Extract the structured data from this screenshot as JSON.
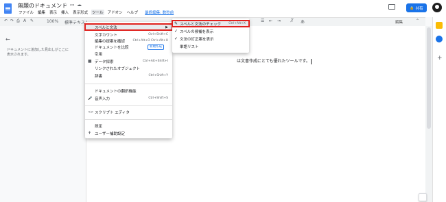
{
  "header": {
    "doc_title": "無題のドキュメント",
    "star_icon": "☆",
    "menus": [
      "ファイル",
      "編集",
      "表示",
      "挿入",
      "表示形式",
      "ツール",
      "アドオン",
      "ヘルプ"
    ],
    "last_edit": "最終編集: 数秒前",
    "share_label": "共有"
  },
  "toolbar": {
    "zoom": "100%",
    "style": "標準テキスト",
    "mode": "編集"
  },
  "outline": {
    "text": "ドキュメントに追加した見出しがここに表示されます。"
  },
  "document": {
    "body_text": "は文書作成にとても優れたツールです。"
  },
  "tools_menu": {
    "items": [
      {
        "label": "スペルと文法",
        "shortcut": "",
        "icon": ""
      },
      {
        "label": "文字カウント",
        "shortcut": "Ctrl+Shift+C",
        "icon": ""
      },
      {
        "label": "編集の提案を確認",
        "shortcut": "Ctrl+Alt+O Ctrl+Alt+U",
        "icon": ""
      },
      {
        "label": "ドキュメントを比較",
        "shortcut": "",
        "icon": "",
        "badge": "新規作成"
      },
      {
        "label": "引用",
        "shortcut": "",
        "icon": ""
      },
      {
        "label": "データ探索",
        "shortcut": "Ctrl+Alt+Shift+I",
        "icon": "■"
      },
      {
        "label": "リンクされたオブジェクト",
        "shortcut": "",
        "icon": ""
      },
      {
        "label": "辞書",
        "shortcut": "Ctrl+Shift+Y",
        "icon": ""
      },
      {
        "label": "ドキュメントの翻訳機能",
        "shortcut": "",
        "icon": ""
      },
      {
        "label": "音声入力",
        "shortcut": "Ctrl+Shift+S",
        "icon": "🎤"
      },
      {
        "label": "スクリプト エディタ",
        "shortcut": "",
        "icon": "<>"
      },
      {
        "label": "設定",
        "shortcut": "",
        "icon": ""
      },
      {
        "label": "ユーザー補助設定",
        "shortcut": "",
        "icon": "✝"
      }
    ]
  },
  "submenu": {
    "items": [
      {
        "label": "スペルと文法のチェック",
        "shortcut": "Ctrl+Alt+X",
        "check": "✎"
      },
      {
        "label": "スペルの候補を表示",
        "shortcut": "",
        "check": "✓"
      },
      {
        "label": "文法の訂正案を表示",
        "shortcut": "",
        "check": "✓"
      },
      {
        "label": "単語リスト",
        "shortcut": "",
        "check": ""
      }
    ]
  },
  "colors": {
    "accent": "#1a73e8",
    "highlight_border": "#e0201c",
    "menu_hover": "#e8eaed"
  }
}
